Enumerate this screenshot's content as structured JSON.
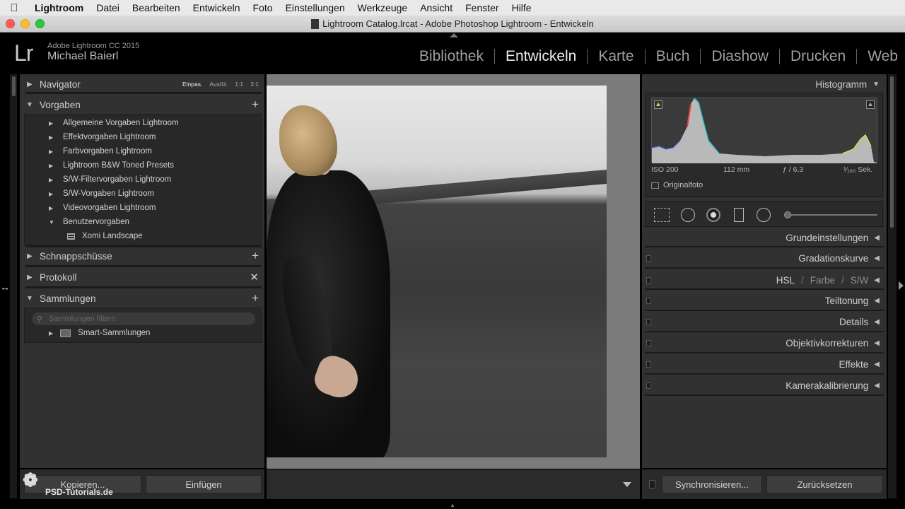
{
  "menubar": {
    "apple_icon": "apple-logo",
    "items": [
      "Lightroom",
      "Datei",
      "Bearbeiten",
      "Entwickeln",
      "Foto",
      "Einstellungen",
      "Werkzeuge",
      "Ansicht",
      "Fenster",
      "Hilfe"
    ]
  },
  "window": {
    "title": "Lightroom Catalog.lrcat - Adobe Photoshop Lightroom - Entwickeln"
  },
  "identity": {
    "logo": "Lr",
    "version": "Adobe Lightroom CC 2015",
    "user": "Michael Baierl"
  },
  "modules": [
    "Bibliothek",
    "Entwickeln",
    "Karte",
    "Buch",
    "Diashow",
    "Drucken",
    "Web"
  ],
  "active_module": "Entwickeln",
  "left": {
    "navigator": {
      "label": "Navigator",
      "zoom": [
        "Einpas.",
        "Ausfül.",
        "1:1",
        "3:1"
      ],
      "selected_zoom": "Einpas."
    },
    "presets": {
      "label": "Vorgaben",
      "items": [
        "Allgemeine Vorgaben Lightroom",
        "Effektvorgaben Lightroom",
        "Farbvorgaben Lightroom",
        "Lightroom B&W Toned Presets",
        "S/W-Filtervorgaben Lightroom",
        "S/W-Vorgaben Lightroom",
        "Videovorgaben Lightroom",
        "Benutzervorgaben"
      ],
      "user_preset": "Xomi Landscape"
    },
    "snapshots": {
      "label": "Schnappschüsse"
    },
    "history": {
      "label": "Protokoll"
    },
    "collections": {
      "label": "Sammlungen",
      "search_placeholder": "Sammlungen filtern",
      "items": [
        "Smart-Sammlungen"
      ]
    },
    "copy_button": "Kopieren...",
    "paste_button": "Einfügen"
  },
  "watermark": "PSD-Tutorials.de",
  "right": {
    "histogram": {
      "label": "Histogramm",
      "iso": "ISO 200",
      "focal": "112 mm",
      "aperture": "ƒ / 6,3",
      "shutter": "¹⁄₁₆₀ Sek.",
      "original_photo": "Originalfoto"
    },
    "sections": [
      {
        "label": "Grundeinstellungen"
      },
      {
        "label": "Gradationskurve"
      },
      {
        "label": "Teiltonung"
      },
      {
        "label": "Details"
      },
      {
        "label": "Objektivkorrekturen"
      },
      {
        "label": "Effekte"
      },
      {
        "label": "Kamerakalibrierung"
      }
    ],
    "hsl": {
      "hsl": "HSL",
      "farbe": "Farbe",
      "sw": "S/W"
    },
    "sync_button": "Synchronisieren...",
    "reset_button": "Zurücksetzen"
  },
  "colors": {
    "panel": "#313131",
    "background": "#000000",
    "text": "#cfcfcf",
    "active_module": "#ececec"
  }
}
